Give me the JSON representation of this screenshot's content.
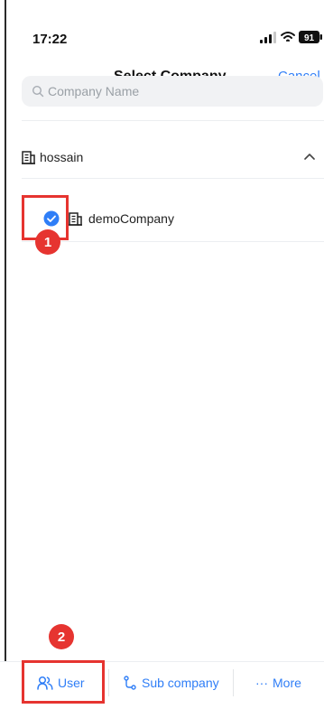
{
  "status_bar": {
    "time": "17:22",
    "battery": "91"
  },
  "header": {
    "title": "Select Company",
    "cancel_label": "Cancel"
  },
  "search": {
    "placeholder": "Company Name",
    "value": ""
  },
  "companies": {
    "parent": {
      "label": "hossain",
      "expanded": true
    },
    "children": [
      {
        "label": "demoCompany",
        "selected": true
      }
    ]
  },
  "annotations": {
    "badge_1": "1",
    "badge_2": "2"
  },
  "bottom_bar": {
    "user_label": "User",
    "sub_company_label": "Sub company",
    "more_label": "More",
    "more_prefix": "···"
  },
  "colors": {
    "accent": "#2f7ef7",
    "annotation": "#e63430",
    "search_bg": "#f1f2f4",
    "text": "#222222"
  },
  "icons": {
    "signal": "signal-icon",
    "wifi": "wifi-icon",
    "battery": "battery-icon",
    "search": "search-icon",
    "building": "building-icon",
    "chevron": "chevron-up-icon",
    "check": "check-circle-icon",
    "user": "user-group-icon",
    "sub_company": "hierarchy-icon"
  }
}
